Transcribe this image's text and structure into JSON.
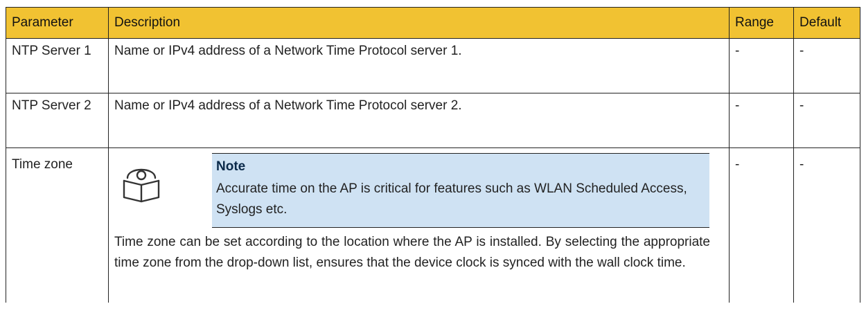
{
  "table": {
    "headers": {
      "parameter": "Parameter",
      "description": "Description",
      "range": "Range",
      "default": "Default"
    },
    "rows": [
      {
        "parameter": "NTP Server 1",
        "description": "Name or IPv4 address of a Network Time Protocol server 1.",
        "range": "-",
        "default": "-"
      },
      {
        "parameter": "NTP Server 2",
        "description": "Name or IPv4 address of a Network Time Protocol server 2.",
        "range": "-",
        "default": "-"
      },
      {
        "parameter": "Time zone",
        "note": {
          "icon": "book-reader-icon",
          "title": "Note",
          "text": "Accurate time on the AP is critical for features such as WLAN Scheduled Access, Syslogs etc."
        },
        "description": "Time zone can be set according to the location where the AP is installed. By selecting the appropriate time zone from the drop-down list, ensures that the device clock is synced with the wall clock time.",
        "range": "-",
        "default": "-"
      }
    ]
  },
  "colors": {
    "header_bg": "#f1c232",
    "note_bg": "#cfe2f3",
    "border": "#222222"
  }
}
